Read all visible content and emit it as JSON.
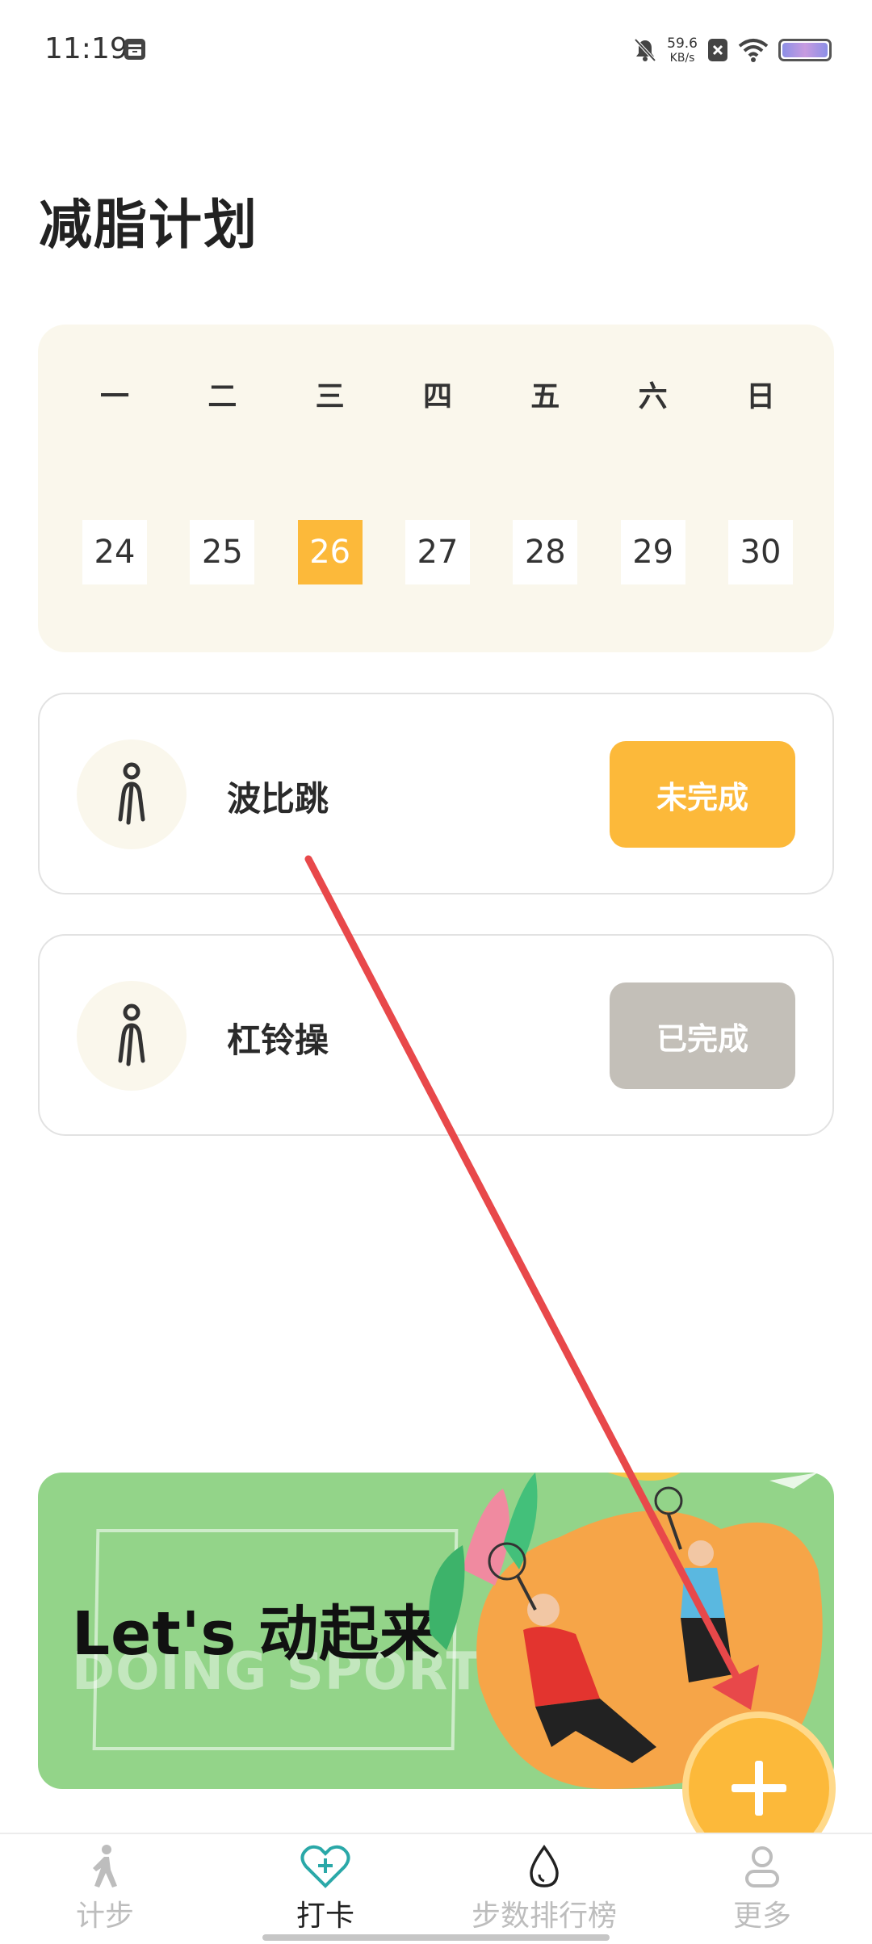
{
  "status_bar": {
    "time": "11:19",
    "net_speed_value": "59.6",
    "net_speed_unit": "KB/s",
    "icons": [
      "notification-app-icon",
      "bell-mute-icon",
      "sim-blocked-icon",
      "wifi-icon",
      "battery-icon"
    ]
  },
  "page": {
    "title": "减脂计划"
  },
  "calendar": {
    "weekdays": [
      "一",
      "二",
      "三",
      "四",
      "五",
      "六",
      "日"
    ],
    "days": [
      "24",
      "25",
      "26",
      "27",
      "28",
      "29",
      "30"
    ],
    "selected_day": "26",
    "accent_color": "#fcb93a"
  },
  "tasks": [
    {
      "name": "波比跳",
      "status_label": "未完成",
      "status": "pending",
      "icon": "person-exercise-icon"
    },
    {
      "name": "杠铃操",
      "status_label": "已完成",
      "status": "done",
      "icon": "person-exercise-icon"
    }
  ],
  "banner": {
    "title": "Let's 动起来",
    "subtitle": "DOING SPORT"
  },
  "fab": {
    "icon": "plus-icon"
  },
  "bottom_nav": {
    "items": [
      {
        "label": "计步",
        "icon": "walking-icon",
        "active": false
      },
      {
        "label": "打卡",
        "icon": "heart-plus-icon",
        "active": true
      },
      {
        "label": "步数排行榜",
        "icon": "water-drop-icon",
        "active": false
      },
      {
        "label": "更多",
        "icon": "user-icon",
        "active": false
      }
    ]
  },
  "colors": {
    "accent": "#fcb93a",
    "done_gray": "#c3bfb8",
    "calendar_bg": "#faf7ec",
    "banner_bg": "#93d489",
    "annotation_arrow": "#e8484a"
  }
}
